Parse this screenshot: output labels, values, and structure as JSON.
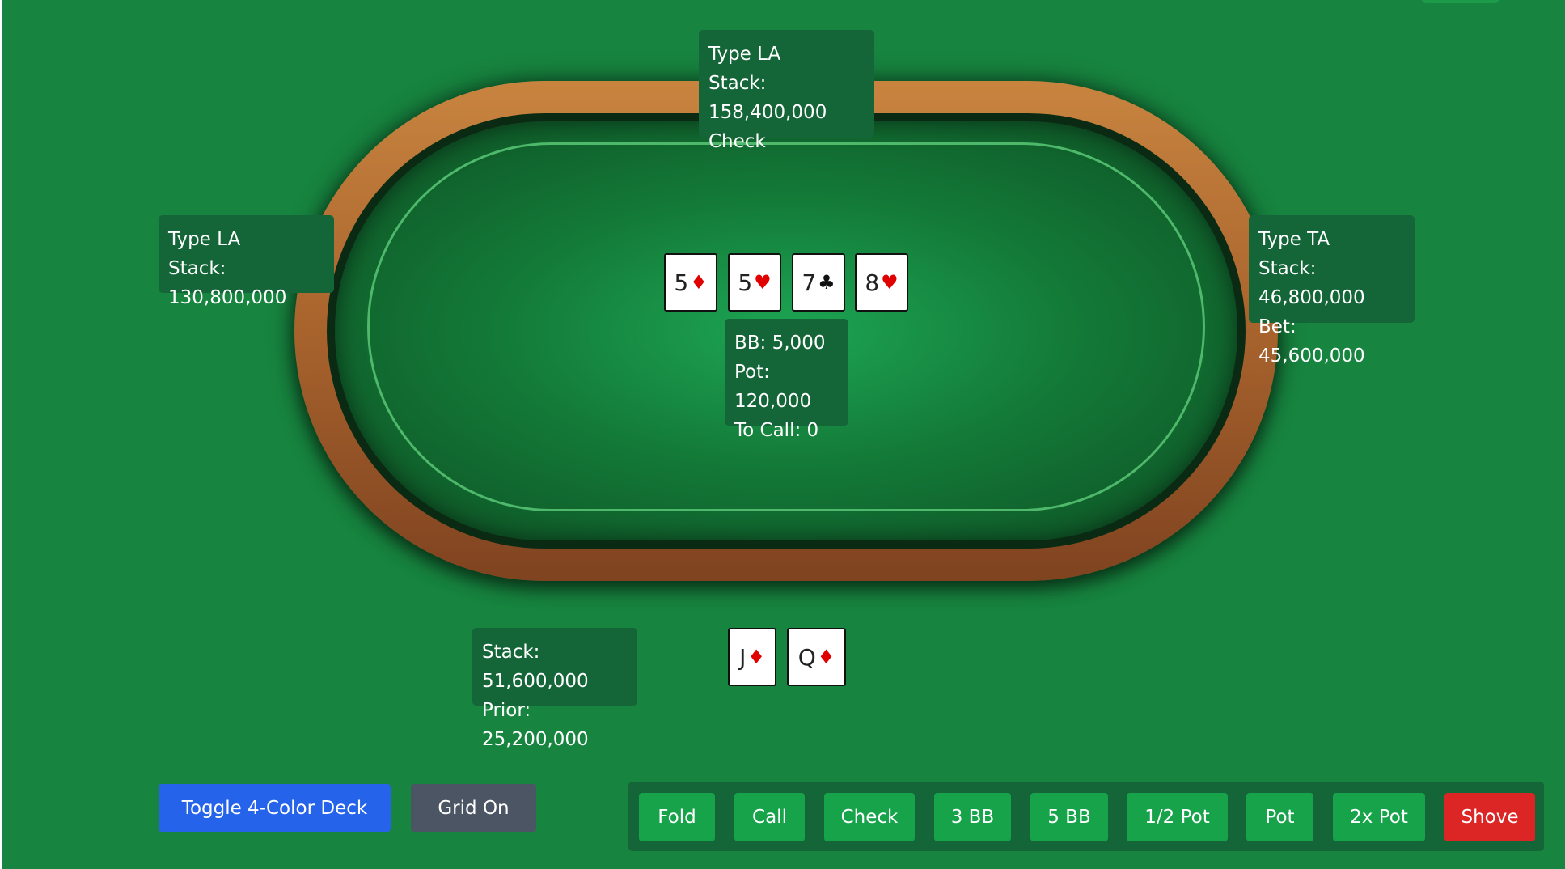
{
  "ui": {
    "colors": {
      "felt": "#17843f",
      "info_box": "#146638",
      "toggle_btn": "#2563eb",
      "grid_btn": "#4b5563",
      "action_btn": "#16a34a",
      "shove_btn": "#dc2626",
      "red_suit": "#e00000",
      "black_suit": "#111111"
    }
  },
  "players": {
    "top": {
      "type": "Type LA",
      "stack": "Stack: 158,400,000",
      "action": "Check"
    },
    "left": {
      "type": "Type LA",
      "stack": "Stack: 130,800,000"
    },
    "right": {
      "type": "Type TA",
      "stack": "Stack: 46,800,000",
      "bet": "Bet: 45,600,000"
    },
    "hero": {
      "stack": "Stack: 51,600,000",
      "prior": "Prior: 25,200,000"
    }
  },
  "board": {
    "cards": [
      {
        "rank": "5",
        "suit": "♦",
        "color": "red"
      },
      {
        "rank": "5",
        "suit": "♥",
        "color": "red"
      },
      {
        "rank": "7",
        "suit": "♣",
        "color": "black"
      },
      {
        "rank": "8",
        "suit": "♥",
        "color": "red"
      }
    ]
  },
  "hand": {
    "cards": [
      {
        "rank": "J",
        "suit": "♦",
        "color": "red"
      },
      {
        "rank": "Q",
        "suit": "♦",
        "color": "red"
      }
    ]
  },
  "pot_info": {
    "bb": "BB: 5,000",
    "pot": "Pot: 120,000",
    "to_call": "To Call: 0"
  },
  "controls": {
    "toggle_deck": "Toggle 4-Color Deck",
    "grid": "Grid On"
  },
  "actions": {
    "fold": "Fold",
    "call": "Call",
    "check": "Check",
    "bb3": "3 BB",
    "bb5": "5 BB",
    "half_pot": "1/2 Pot",
    "pot": "Pot",
    "pot2x": "2x Pot",
    "shove": "Shove"
  }
}
